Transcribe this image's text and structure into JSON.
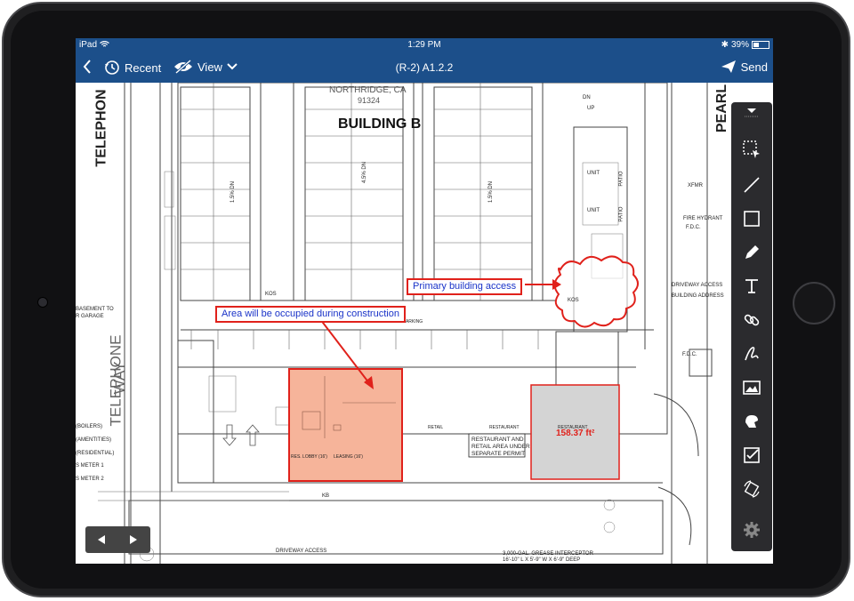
{
  "status_bar": {
    "carrier": "iPad",
    "time": "1:29 PM",
    "battery": "39%",
    "battery_level": 0.39
  },
  "nav": {
    "recent": "Recent",
    "view": "View",
    "title": "(R-2) A1.2.2",
    "send": "Send"
  },
  "drawing": {
    "building_title": "BUILDING B",
    "address_city": "NORTHRIDGE, CA",
    "address_zip": "91324",
    "street_left": "TELEPHON",
    "street_right": "PEARL",
    "telephone_way_1": "TELEPHONE",
    "telephone_way_2": "WAY",
    "slope_1": "1.5% DN",
    "slope_2": "4.5% DN",
    "slope_3": "1.5% DN",
    "dn": "DN",
    "up": "UP",
    "unit_1": "UNIT",
    "unit_2": "UNIT",
    "patio_1": "PATIO",
    "patio_2": "PATIO",
    "xfmr": "XFMR",
    "fire_hydrant": "FIRE HYDRANT",
    "fdc_1": "F.D.C.",
    "fdc_2": "F.D.C.",
    "driveway_access_right": "DRIVEWAY ACCESS",
    "building_address": "BUILDING ADDRESS",
    "kos_1": "KOS",
    "kos_2": "KOS",
    "basement_1": "BASEMENT TO",
    "basement_2": "R GARAGE",
    "parking": "PARKING",
    "boilers": "(BOILERS)",
    "amenities": "(AMENTITIES)",
    "residential": "(RESIDENTIAL)",
    "meter_1": "S METER 1",
    "meter_2": "S METER 2",
    "res_lobby": "RES. LOBBY (16')",
    "leasing": "LEASING (16')",
    "retail": "RETAIL",
    "restaurant_1": "RESTAURANT",
    "restaurant_2": "RESTAURANT",
    "separate_permit_1": "RESTAURANT AND",
    "separate_permit_2": "RETAIL AREA UNDER",
    "separate_permit_3": "SEPARATE PERMIT",
    "kb": "KB",
    "driveway_access_bottom": "DRIVEWAY ACCESS",
    "grease_1": "3,000-GAL. GREASE INTERCEPTOR",
    "grease_2": "16'-10\" L X 5'-9\" W X 6'-9\" DEEP"
  },
  "annotations": {
    "primary_access": "Primary building access",
    "construction_area": "Area will be occupied during construction",
    "area_measurement": "158.37 ft²"
  },
  "toolbar": [
    "toolbar-collapse",
    "select-tool",
    "line-tool",
    "rectangle-tool",
    "pen-tool",
    "text-tool",
    "link-tool",
    "signature-tool",
    "image-tool",
    "stamp-tool",
    "form-tool",
    "rotate-tool",
    "settings"
  ],
  "colors": {
    "nav": "#1c4f8a",
    "markup_red": "#e0211b",
    "markup_blue": "#1a33c8",
    "construction_fill": "#f6b49a",
    "restaurant_fill": "#d4d4d4"
  }
}
